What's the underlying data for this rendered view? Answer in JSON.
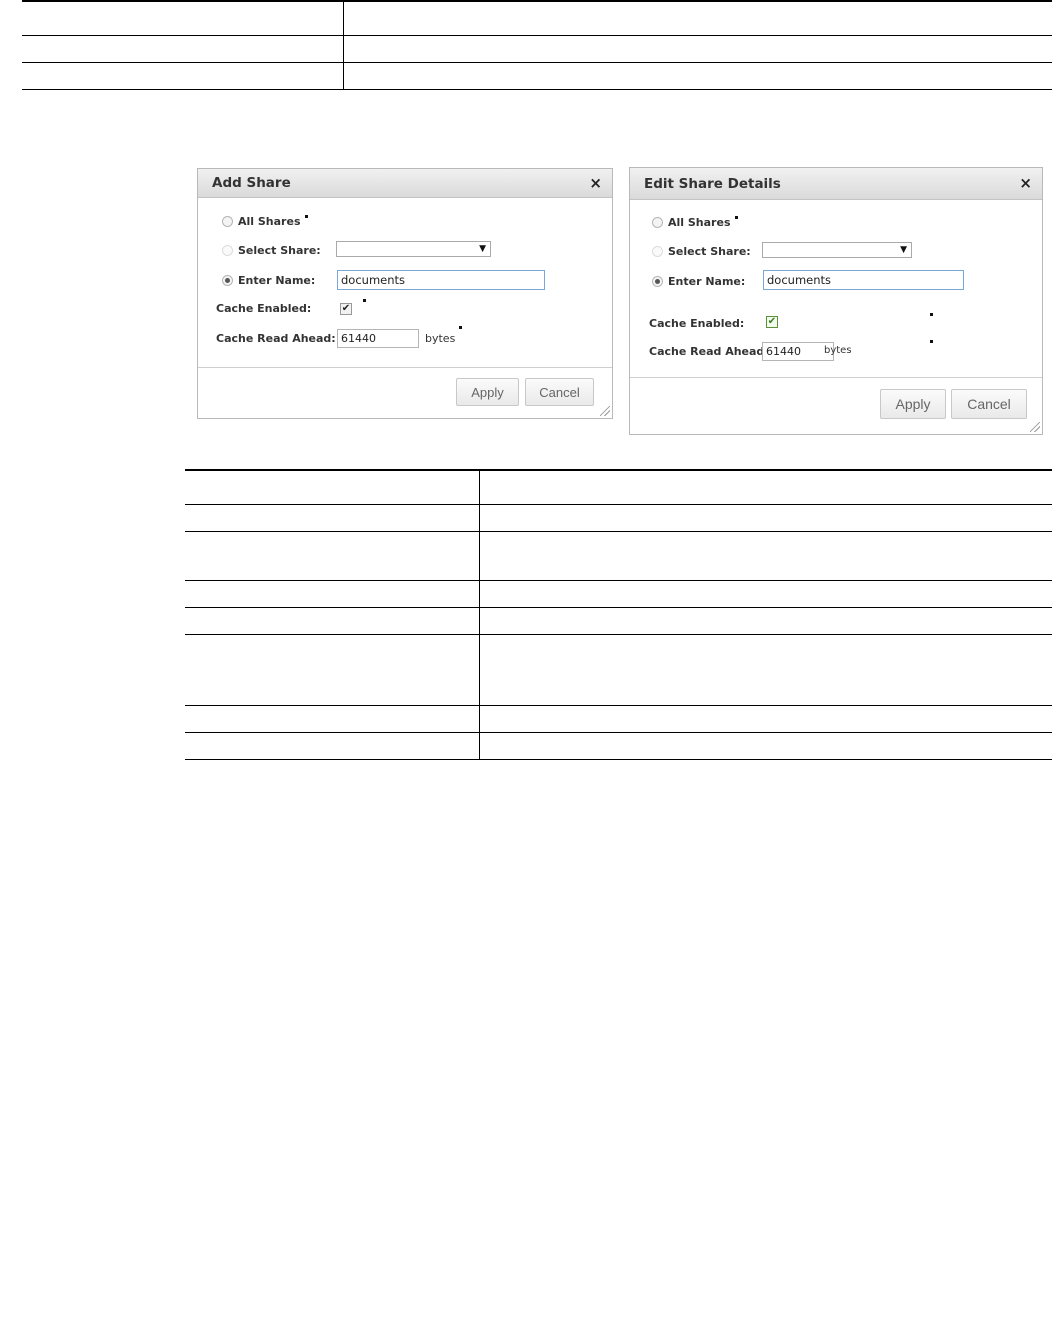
{
  "dialog_left": {
    "title": "Add Share",
    "all_shares": "All Shares",
    "select_share": "Select Share:",
    "enter_name": "Enter Name:",
    "name_value": "documents",
    "cache_enabled": "Cache Enabled:",
    "cache_read_ahead": "Cache Read Ahead:",
    "read_ahead_value": "61440",
    "unit": "bytes",
    "apply": "Apply",
    "cancel": "Cancel",
    "close": "×",
    "check": "✔"
  },
  "dialog_right": {
    "title": "Edit Share Details",
    "all_shares": "All Shares",
    "select_share": "Select Share:",
    "enter_name": "Enter Name:",
    "name_value": "documents",
    "cache_enabled": "Cache Enabled:",
    "cache_read_ahead": "Cache Read Ahead:",
    "read_ahead_value": "61440",
    "unit": "bytes",
    "apply": "Apply",
    "cancel": "Cancel",
    "close": "×",
    "check": "✔"
  },
  "dropdown_arrow": "▼"
}
